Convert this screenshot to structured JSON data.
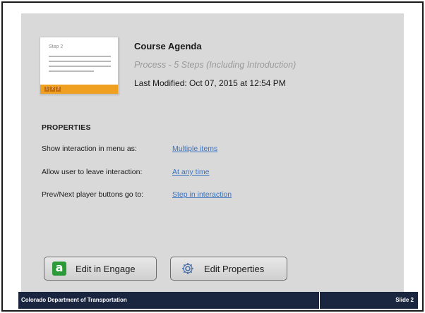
{
  "interaction": {
    "thumbnail_step": "Step 2",
    "thumbnail_steps": [
      "1",
      "2",
      "3"
    ],
    "title": "Course Agenda",
    "subtitle": "Process - 5 Steps (Including Introduction)",
    "last_modified": "Last Modified: Oct 07, 2015 at 12:54 PM"
  },
  "properties": {
    "heading": "PROPERTIES",
    "items": [
      {
        "label": "Show interaction in menu as:",
        "value": "Multiple items"
      },
      {
        "label": "Allow user to leave interaction:",
        "value": "At any time"
      },
      {
        "label": "Prev/Next player buttons go to:",
        "value": "Step in interaction"
      }
    ]
  },
  "buttons": {
    "engage_icon_glyph": "a",
    "edit_engage": "Edit in Engage",
    "edit_properties": "Edit Properties"
  },
  "footer": {
    "organization": "Colorado Department of Transportation",
    "slide": "Slide 2"
  },
  "colors": {
    "panel": "#d9d9d9",
    "link": "#3a72c2",
    "footer": "#1a2540",
    "engage_green": "#2d9a3a",
    "thumb_orange": "#f0a020"
  }
}
